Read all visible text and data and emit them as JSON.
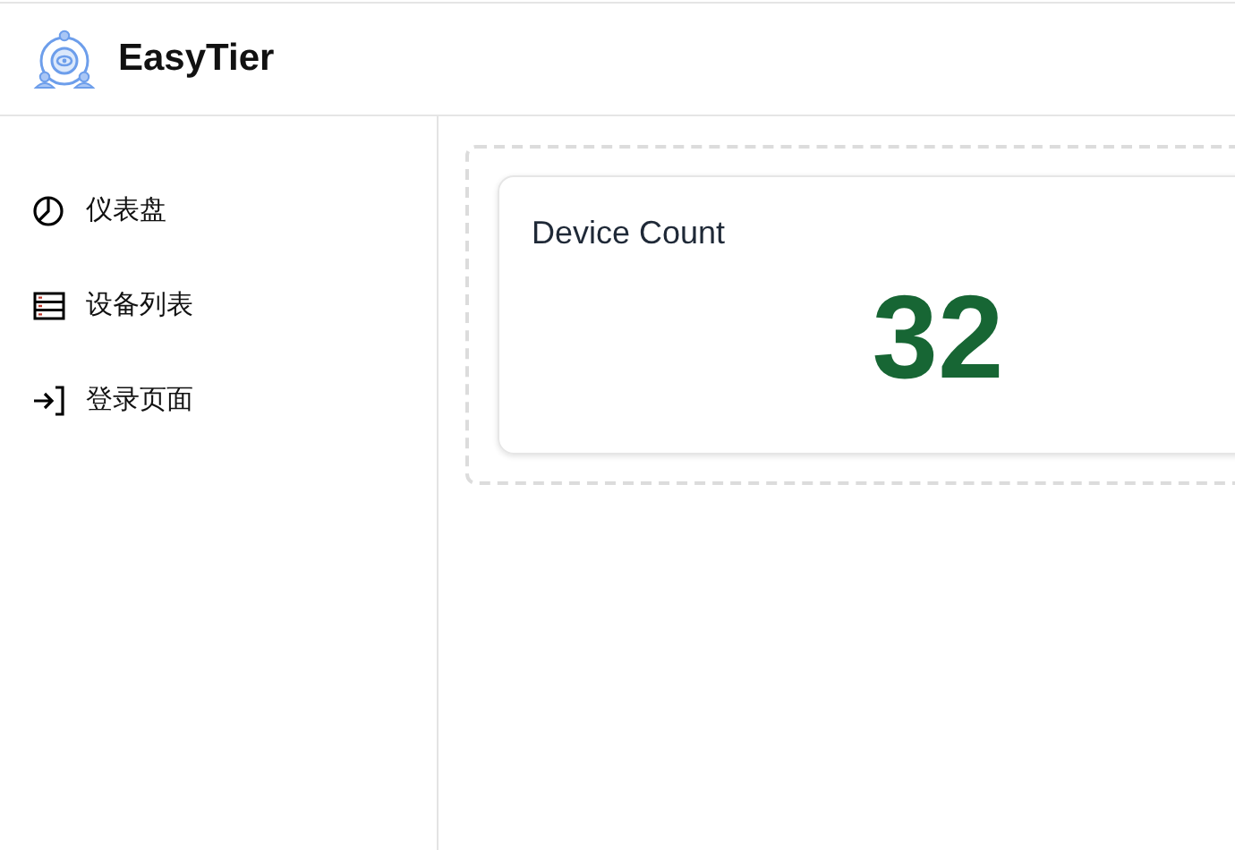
{
  "header": {
    "title": "EasyTier"
  },
  "sidebar": {
    "items": [
      {
        "label": "仪表盘"
      },
      {
        "label": "设备列表"
      },
      {
        "label": "登录页面"
      }
    ]
  },
  "stat_card": {
    "label": "Device Count",
    "value": "32"
  }
}
